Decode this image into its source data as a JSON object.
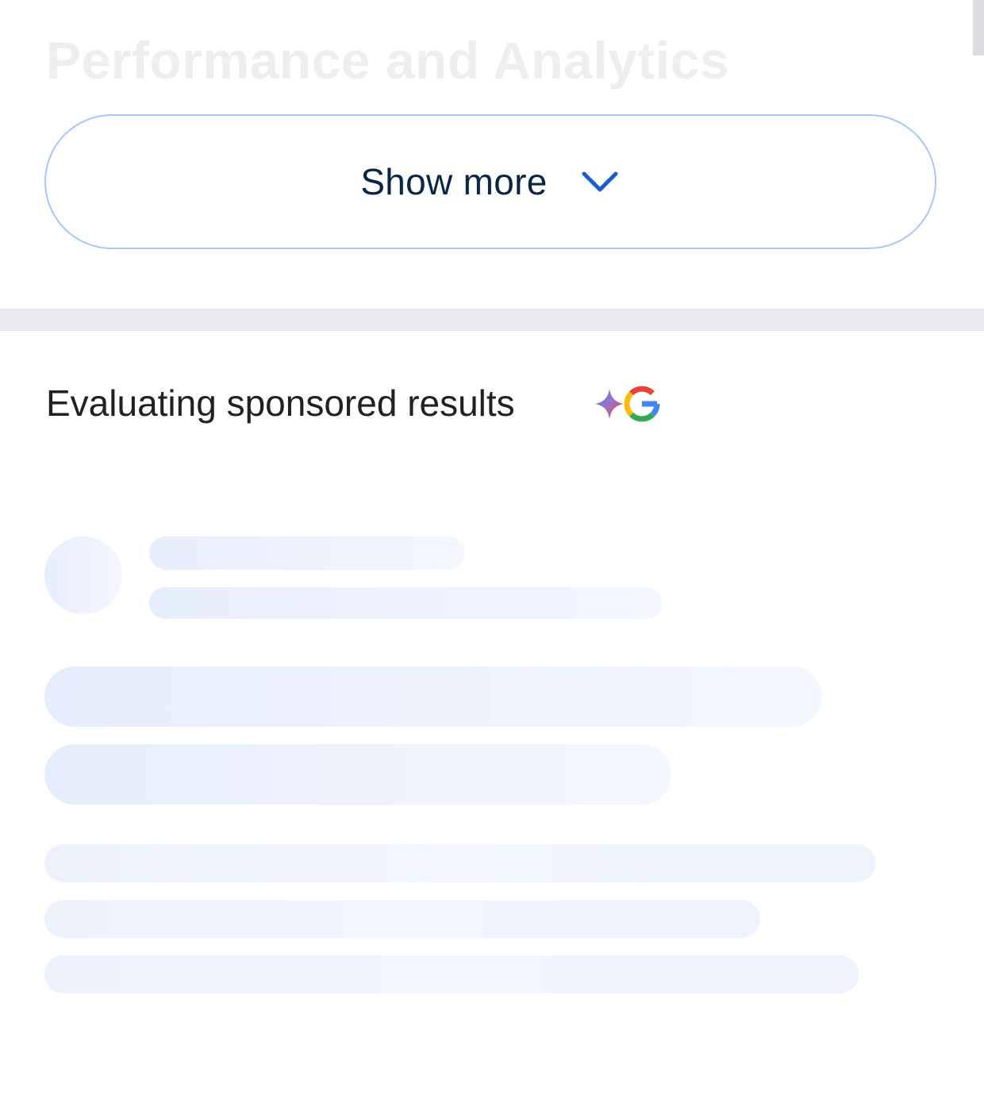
{
  "previous_section": {
    "heading": "Performance and Analytics"
  },
  "expand_button": {
    "label": "Show more",
    "icon": "chevron-down-icon"
  },
  "ai_section": {
    "title": "Evaluating sponsored results",
    "badge_icon": "gemini-google-icon",
    "loading": true
  },
  "colors": {
    "button_border": "#a8c7fa",
    "button_text": "#0b2545",
    "chevron": "#1a5fd0",
    "divider": "#e8eaed",
    "skeleton": "#e6edfc"
  }
}
